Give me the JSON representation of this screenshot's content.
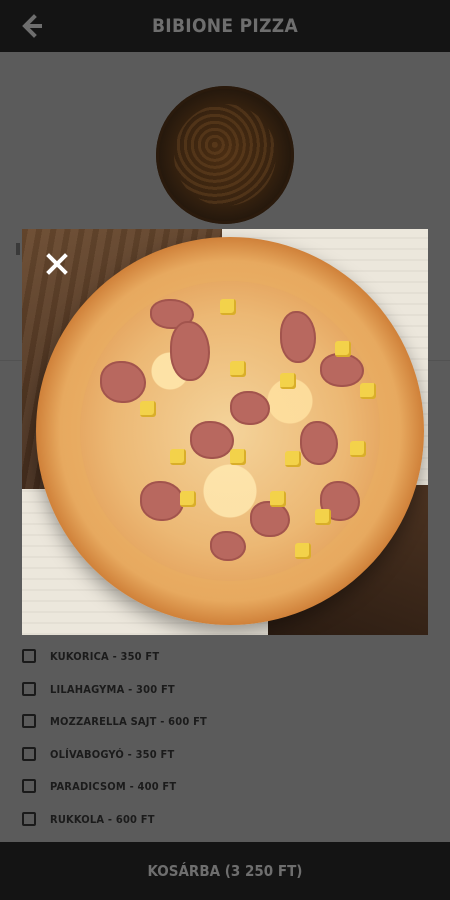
{
  "header": {
    "title": "BIBIONE PIZZA",
    "back_icon": "arrow-left-icon"
  },
  "modal": {
    "close_icon": "close-icon",
    "image_alt": "pizza-photo"
  },
  "ingredients": [
    {
      "label": "KUKORICA - 350 FT",
      "checked": false
    },
    {
      "label": "LILAHAGYMA - 300 FT",
      "checked": false
    },
    {
      "label": "MOZZARELLA SAJT - 600 FT",
      "checked": false
    },
    {
      "label": "OLÍVABOGYÓ - 350 FT",
      "checked": false
    },
    {
      "label": "PARADICSOM - 400 FT",
      "checked": false
    },
    {
      "label": "RUKKOLA - 600 FT",
      "checked": false
    }
  ],
  "footer": {
    "cart_button_label": "KOSÁRBA (3 250 FT)"
  },
  "colors": {
    "bars": "#141414",
    "overlay": "#5b5b5b",
    "bar_text": "#6e6e6e"
  }
}
